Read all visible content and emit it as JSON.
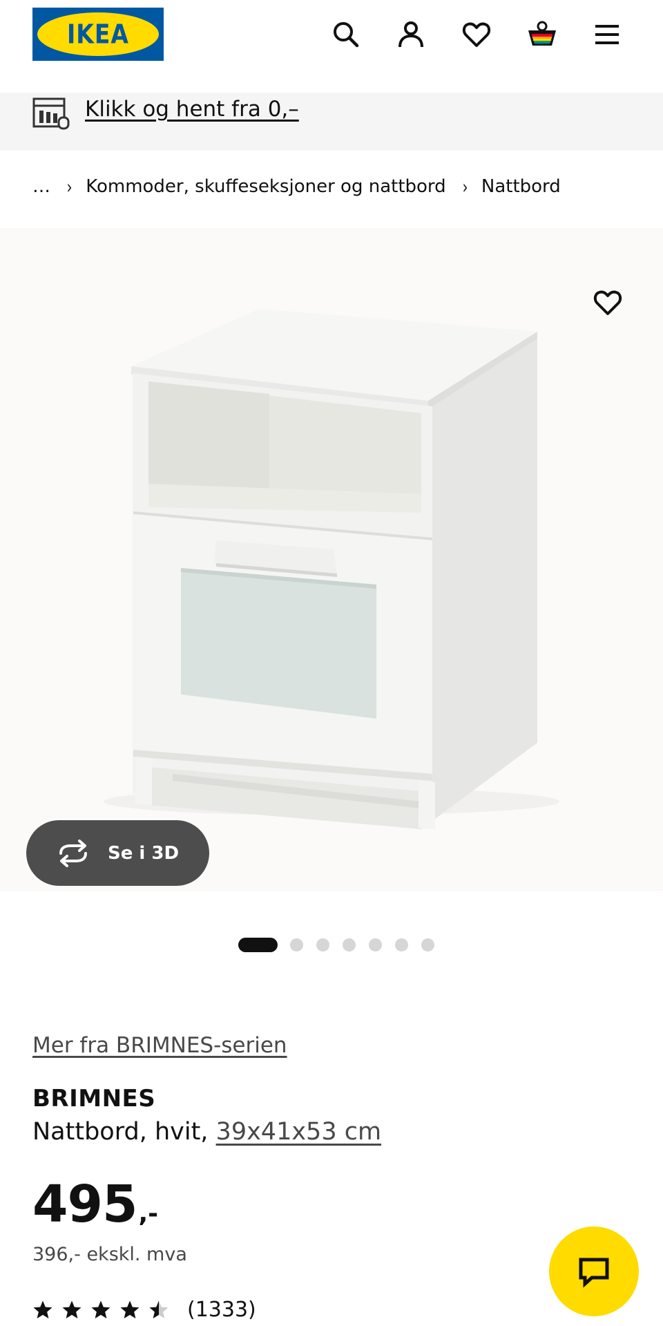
{
  "header": {
    "logo_text": "IKEA",
    "icons": [
      "search-icon",
      "user-icon",
      "heart-icon",
      "cart-icon",
      "menu-icon"
    ]
  },
  "promo": {
    "icon": "store-icon",
    "text": "Klikk og hent fra 0,–"
  },
  "breadcrumb": {
    "ellipsis": "…",
    "sep": "›",
    "items": [
      "Kommoder, skuffeseksjoner og nattbord",
      "Nattbord"
    ]
  },
  "gallery": {
    "view_3d_label": "Se i 3D",
    "image_count": 7,
    "active_index": 0
  },
  "product": {
    "series_link": "Mer fra BRIMNES-serien",
    "name": "BRIMNES",
    "description": "Nattbord, hvit, ",
    "size": "39x41x53 cm",
    "price_integer": "495",
    "price_suffix": ",-",
    "price_ex_vat": "396,- ekskl. mva",
    "rating_value": 4.5,
    "rating_count": "(1333)"
  },
  "colors": {
    "ikea_blue": "#0058A3",
    "ikea_yellow": "#FFDB00",
    "text_dark": "#111111",
    "button_dark": "#4D4D4D"
  }
}
